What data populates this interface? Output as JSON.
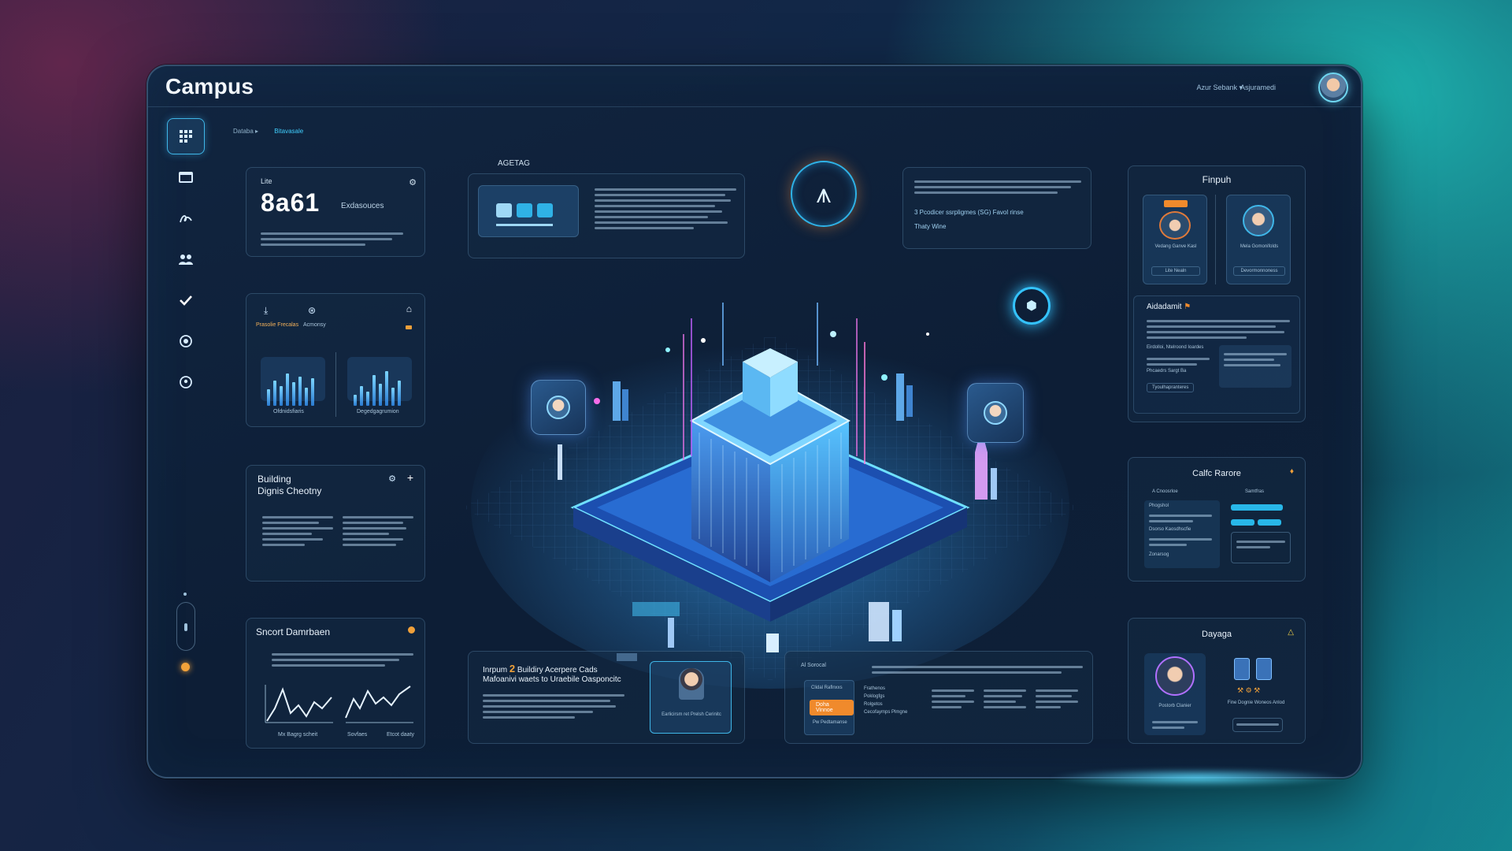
{
  "app": {
    "title": "Campus"
  },
  "header": {
    "menu_1": "Azur Sebank ▾",
    "menu_2": "Asjuramedi"
  },
  "breadcrumb": {
    "item_1": "Databa ▸",
    "item_2": "Bitavasale"
  },
  "sidebar": {
    "items": [
      {
        "icon": "grid-icon"
      },
      {
        "icon": "window-icon"
      },
      {
        "icon": "signature-icon"
      },
      {
        "icon": "people-icon"
      },
      {
        "icon": "check-icon"
      },
      {
        "icon": "target-icon"
      },
      {
        "icon": "location-icon"
      }
    ]
  },
  "stat_card": {
    "label": "Lite",
    "value": "8a61",
    "unit": "Exdasouces"
  },
  "charts_card": {
    "label_1": "Prasolie Frecalas",
    "label_2": "Acmonsy",
    "chart_1_label": "Ofdnidsfiaris",
    "chart_2_label": "Degedgagrumion",
    "bars_1": [
      0.45,
      0.7,
      0.55,
      0.9,
      0.65,
      0.8,
      0.5,
      0.75
    ],
    "bars_2": [
      0.3,
      0.55,
      0.4,
      0.85,
      0.6,
      0.95,
      0.5,
      0.7
    ]
  },
  "building_card": {
    "title_line_1": "Building",
    "title_line_2": "Dignis Cheotny"
  },
  "smart_card": {
    "title": "Sncort Damrbaen",
    "label_1": "Mx Bagrg scheit",
    "label_2": "Sovfaes",
    "label_3": "Etcot daaty"
  },
  "top_center": {
    "tag": "ΑGΕΤΑG"
  },
  "top_right_text": {
    "line_1": "3 Pcodicer ssrpligmes (SG) Favol rinse",
    "line_2": "Thaty Wine"
  },
  "bottom_center": {
    "title_prefix": "Inrpum",
    "title_number": "2",
    "title_suffix": "Buildiry Acerpere Cads",
    "subtitle": "Mafoanivi waets to Uraebile Oasponcitc",
    "profile_caption": "Earlicirsm ret Prelsh Cerinitc"
  },
  "bottom_right": {
    "header": "Al Sorocal",
    "badge": "Clidal Raflnxxs",
    "button": "Doha Vinnoe",
    "footer": "Pw Pedtamanse",
    "list": [
      "Frathenos",
      "Poklogfgs",
      "Rolgetos",
      "Cecofaymps Plmgne"
    ]
  },
  "finpoh": {
    "title": "Finpuh",
    "person_1": "Vedang Ganve Kasl",
    "person_2": "Mela Gomonifolds",
    "button_1": "Lite Nealn",
    "button_2": "Devormonnoness"
  },
  "adradomt": {
    "title": "Aidadamit",
    "section_1": "Eirdolloi, Ntelroond Ioardes",
    "section_2": "Phcaedrs Sargt Ba",
    "button": "Tyoulhapranteres"
  },
  "calc_card": {
    "title": "Calfc Rarore",
    "col_1": "A Cnoosrloe",
    "col_2": "Samtfras",
    "item_1": "Phogshol",
    "item_2": "Dsorso Kaosdhscfie",
    "item_3": "Zonarsog"
  },
  "dayaga": {
    "title": "Dayaga",
    "person_caption": "Postorb Clanier",
    "right_caption": "Fine Dognie Woneos Anlod"
  },
  "colors": {
    "accent": "#3fb6e8",
    "orange": "#f08a2c",
    "panel": "#0d1e36"
  }
}
